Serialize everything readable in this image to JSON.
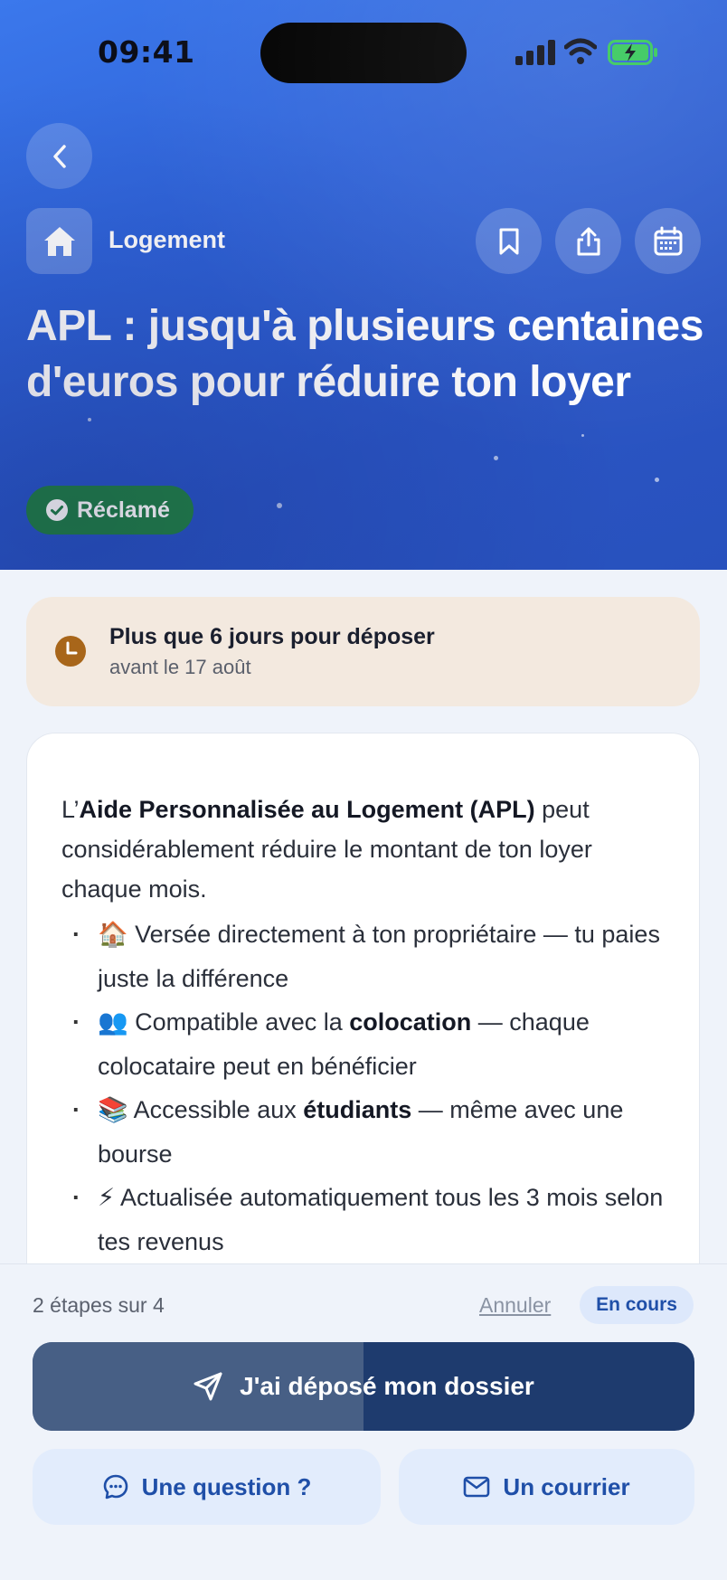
{
  "status_bar": {
    "time": "09:41"
  },
  "header": {
    "category": "Logement",
    "title": "APL : jusqu'à plusieurs centaines d'euros pour réduire ton loyer",
    "badge": "Réclamé"
  },
  "deadline": {
    "title": "Plus que 6 jours pour déposer",
    "subtitle": "avant le 17 août"
  },
  "content": {
    "intro_prefix": "L’",
    "intro_bold": "Aide Personnalisée au Logement (APL)",
    "intro_suffix": " peut considérablement réduire le montant de ton loyer chaque mois.",
    "bullets": [
      {
        "emoji": "🏠",
        "text_before": " Versée directement à ton propriétaire — tu paies juste la différence",
        "bold": "",
        "text_after": ""
      },
      {
        "emoji": "👥",
        "text_before": " Compatible avec la ",
        "bold": "colocation",
        "text_after": " — chaque colocataire peut en bénéficier"
      },
      {
        "emoji": "📚",
        "text_before": " Accessible aux ",
        "bold": "étudiants",
        "text_after": " — même avec une bourse"
      },
      {
        "emoji": "⚡",
        "text_before": " Actualisée automatiquement tous les 3 mois selon tes revenus",
        "bold": "",
        "text_after": ""
      }
    ]
  },
  "footer": {
    "steps": "2 étapes sur 4",
    "progress": 0.5,
    "cancel_label": "Annuler",
    "status_label": "En cours",
    "primary_label": "J'ai déposé mon dossier",
    "question_label": "Une question ?",
    "mail_label": "Un courrier"
  },
  "colors": {
    "hero_blue": "#2f63d8",
    "badge_green": "#23824a",
    "deadline_bg": "#f3e9df",
    "deadline_icon": "#a8661a",
    "primary_dark": "#1e3b6e",
    "primary_progress": "#475f85",
    "accent_blue": "#1f4fa8"
  },
  "icons": {
    "back": "chevron-left-icon",
    "category": "home-icon",
    "bookmark": "bookmark-icon",
    "share": "share-icon",
    "calendar": "calendar-icon",
    "badge": "check-circle-icon",
    "deadline": "clock-icon",
    "primary": "send-icon",
    "question": "chat-bubble-icon",
    "mail": "mail-icon"
  }
}
